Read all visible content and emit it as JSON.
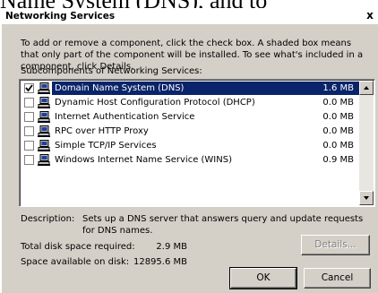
{
  "background": {
    "caption": "Name System (DNS), and to"
  },
  "dialog": {
    "title": "Networking Services",
    "close_glyph": "x",
    "instructions": "To add or remove a component, click the check box. A shaded box means that only part of the component will be installed. To see what's included in a component, click Details.",
    "subcomponents_label": "Subcomponents of Networking Services:",
    "components": [
      {
        "label": "Domain Name System (DNS)",
        "size": "1.6 MB",
        "checked": true,
        "selected": true
      },
      {
        "label": "Dynamic Host Configuration Protocol (DHCP)",
        "size": "0.0 MB",
        "checked": false,
        "selected": false
      },
      {
        "label": "Internet Authentication Service",
        "size": "0.0 MB",
        "checked": false,
        "selected": false
      },
      {
        "label": "RPC over HTTP Proxy",
        "size": "0.0 MB",
        "checked": false,
        "selected": false
      },
      {
        "label": "Simple TCP/IP Services",
        "size": "0.0 MB",
        "checked": false,
        "selected": false
      },
      {
        "label": "Windows Internet Name Service (WINS)",
        "size": "0.9 MB",
        "checked": false,
        "selected": false
      }
    ],
    "description_key": "Description:",
    "description_text": "Sets up a DNS server that answers query and update requests for DNS names.",
    "disk": {
      "required_label": "Total disk space required:",
      "required_value": "2.9 MB",
      "available_label": "Space available on disk:",
      "available_value": "12895.6 MB"
    },
    "buttons": {
      "details": "Details...",
      "ok": "OK",
      "cancel": "Cancel"
    },
    "icons": {
      "component": "computer-network-icon",
      "check": "checkmark-icon",
      "scroll_up": "scroll-up-arrow-icon",
      "scroll_down": "scroll-down-arrow-icon"
    },
    "colors": {
      "face": "#d4d0c8",
      "selection": "#0a246a"
    }
  }
}
